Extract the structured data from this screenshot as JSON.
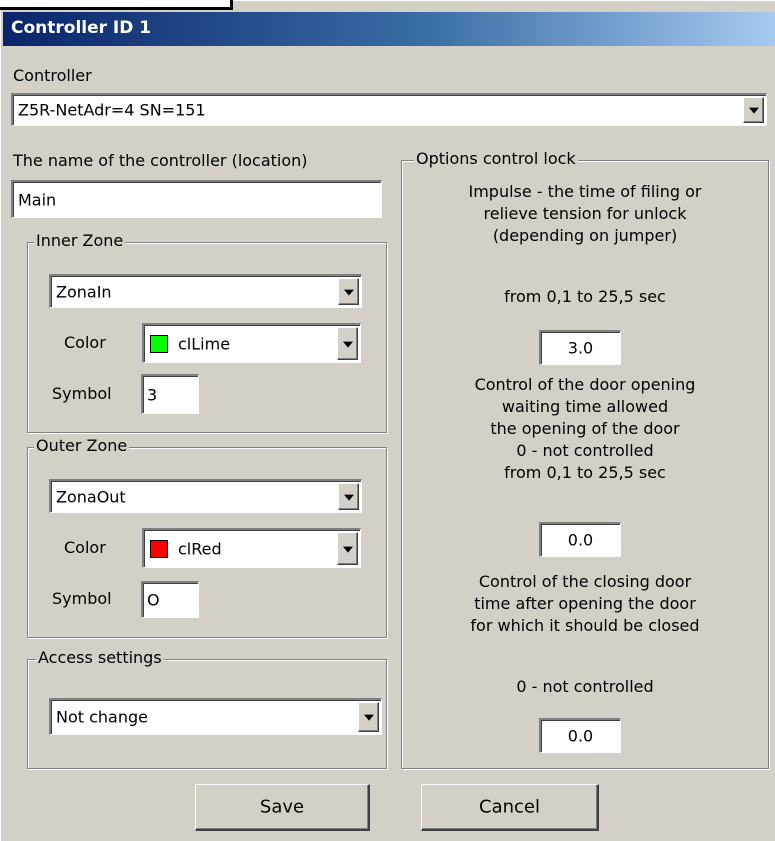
{
  "window": {
    "title": "Controller ID 1"
  },
  "controller": {
    "label": "Controller",
    "value": "Z5R-NetAdr=4 SN=151"
  },
  "name_field": {
    "label": "The name of the controller (location)",
    "value": "Main"
  },
  "inner_zone": {
    "title": "Inner Zone",
    "zone_value": "ZonaIn",
    "color_label": "Color",
    "color_value": "clLime",
    "color_hex": "#00ff00",
    "symbol_label": "Symbol",
    "symbol_value": "3"
  },
  "outer_zone": {
    "title": "Outer Zone",
    "zone_value": "ZonaOut",
    "color_label": "Color",
    "color_value": "clRed",
    "color_hex": "#ff0000",
    "symbol_label": "Symbol",
    "symbol_value": "O"
  },
  "access": {
    "title": "Access settings",
    "value": "Not change"
  },
  "lock_options": {
    "title": "Options control lock",
    "impulse_desc": [
      "Impulse - the time of filing or",
      "relieve tension for unlock",
      "(depending on jumper)"
    ],
    "impulse_range": "from 0,1 to 25,5 sec",
    "impulse_value": "3.0",
    "opening_desc": [
      "Control of the door opening",
      "waiting time allowed",
      "the opening of the door",
      "0 - not controlled",
      "from 0,1 to 25,5 sec"
    ],
    "opening_value": "0.0",
    "closing_desc": [
      "Control of the closing door",
      "time after opening the door",
      "for which it should be closed"
    ],
    "closing_note": "0 - not controlled",
    "closing_value": "0.0"
  },
  "buttons": {
    "save": "Save",
    "cancel": "Cancel"
  }
}
